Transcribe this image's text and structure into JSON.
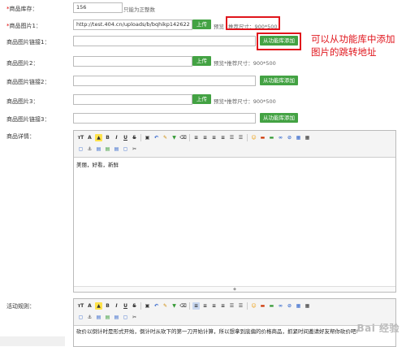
{
  "form": {
    "stock": {
      "label": "商品库存：",
      "value": "156",
      "hint": "只能为正整数"
    },
    "image1": {
      "label": "商品图片1：",
      "value": "http://test.404.cn/uploads/b/bqhikp142622",
      "button": "上传",
      "hint_prefix": "预览",
      "hint_size": "推荐尺寸：900*500"
    },
    "image_link1": {
      "label": "商品图片链接1：",
      "value": "",
      "button": "从功能库添加"
    },
    "image2": {
      "label": "商品图片2：",
      "value": "",
      "button": "上传",
      "hint": "预览*推荐尺寸：900*500"
    },
    "image_link2": {
      "label": "商品图片链接2：",
      "value": "",
      "button": "从功能库添加"
    },
    "image3": {
      "label": "商品图片3：",
      "value": "",
      "button": "上传",
      "hint": "预览*推荐尺寸：900*500"
    },
    "image_link3": {
      "label": "商品图片链接3：",
      "value": "",
      "button": "从功能库添加"
    },
    "details": {
      "label": "商品详情：",
      "content": "美丽，好看，新鲜"
    },
    "rules": {
      "label": "活动规则：",
      "content": "砍价以倒计时是形式开始，倒计时从砍下的第一刀开始计算，所以想拿到底偏的价格商品，抓紧时间邀请好友帮你砍价吧!"
    }
  },
  "annotation": {
    "text": "可以从功能库中添加图片的跳转地址"
  },
  "watermark": "Bai 经验",
  "editor": {
    "font_size_label": "тT",
    "font_label": "A"
  },
  "colors": {
    "green_button": "#43a243",
    "annotation_red": "#e0151c"
  }
}
